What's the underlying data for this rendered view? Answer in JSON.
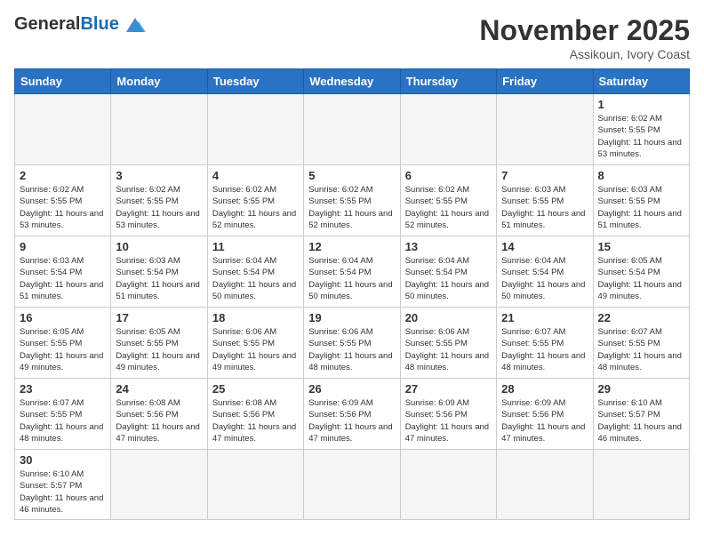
{
  "header": {
    "logo_general": "General",
    "logo_blue": "Blue",
    "month_title": "November 2025",
    "location": "Assikoun, Ivory Coast"
  },
  "weekdays": [
    "Sunday",
    "Monday",
    "Tuesday",
    "Wednesday",
    "Thursday",
    "Friday",
    "Saturday"
  ],
  "weeks": [
    [
      {
        "day": "",
        "info": ""
      },
      {
        "day": "",
        "info": ""
      },
      {
        "day": "",
        "info": ""
      },
      {
        "day": "",
        "info": ""
      },
      {
        "day": "",
        "info": ""
      },
      {
        "day": "",
        "info": ""
      },
      {
        "day": "1",
        "info": "Sunrise: 6:02 AM\nSunset: 5:55 PM\nDaylight: 11 hours\nand 53 minutes."
      }
    ],
    [
      {
        "day": "2",
        "info": "Sunrise: 6:02 AM\nSunset: 5:55 PM\nDaylight: 11 hours\nand 53 minutes."
      },
      {
        "day": "3",
        "info": "Sunrise: 6:02 AM\nSunset: 5:55 PM\nDaylight: 11 hours\nand 53 minutes."
      },
      {
        "day": "4",
        "info": "Sunrise: 6:02 AM\nSunset: 5:55 PM\nDaylight: 11 hours\nand 52 minutes."
      },
      {
        "day": "5",
        "info": "Sunrise: 6:02 AM\nSunset: 5:55 PM\nDaylight: 11 hours\nand 52 minutes."
      },
      {
        "day": "6",
        "info": "Sunrise: 6:02 AM\nSunset: 5:55 PM\nDaylight: 11 hours\nand 52 minutes."
      },
      {
        "day": "7",
        "info": "Sunrise: 6:03 AM\nSunset: 5:55 PM\nDaylight: 11 hours\nand 51 minutes."
      },
      {
        "day": "8",
        "info": "Sunrise: 6:03 AM\nSunset: 5:55 PM\nDaylight: 11 hours\nand 51 minutes."
      }
    ],
    [
      {
        "day": "9",
        "info": "Sunrise: 6:03 AM\nSunset: 5:54 PM\nDaylight: 11 hours\nand 51 minutes."
      },
      {
        "day": "10",
        "info": "Sunrise: 6:03 AM\nSunset: 5:54 PM\nDaylight: 11 hours\nand 51 minutes."
      },
      {
        "day": "11",
        "info": "Sunrise: 6:04 AM\nSunset: 5:54 PM\nDaylight: 11 hours\nand 50 minutes."
      },
      {
        "day": "12",
        "info": "Sunrise: 6:04 AM\nSunset: 5:54 PM\nDaylight: 11 hours\nand 50 minutes."
      },
      {
        "day": "13",
        "info": "Sunrise: 6:04 AM\nSunset: 5:54 PM\nDaylight: 11 hours\nand 50 minutes."
      },
      {
        "day": "14",
        "info": "Sunrise: 6:04 AM\nSunset: 5:54 PM\nDaylight: 11 hours\nand 50 minutes."
      },
      {
        "day": "15",
        "info": "Sunrise: 6:05 AM\nSunset: 5:54 PM\nDaylight: 11 hours\nand 49 minutes."
      }
    ],
    [
      {
        "day": "16",
        "info": "Sunrise: 6:05 AM\nSunset: 5:55 PM\nDaylight: 11 hours\nand 49 minutes."
      },
      {
        "day": "17",
        "info": "Sunrise: 6:05 AM\nSunset: 5:55 PM\nDaylight: 11 hours\nand 49 minutes."
      },
      {
        "day": "18",
        "info": "Sunrise: 6:06 AM\nSunset: 5:55 PM\nDaylight: 11 hours\nand 49 minutes."
      },
      {
        "day": "19",
        "info": "Sunrise: 6:06 AM\nSunset: 5:55 PM\nDaylight: 11 hours\nand 48 minutes."
      },
      {
        "day": "20",
        "info": "Sunrise: 6:06 AM\nSunset: 5:55 PM\nDaylight: 11 hours\nand 48 minutes."
      },
      {
        "day": "21",
        "info": "Sunrise: 6:07 AM\nSunset: 5:55 PM\nDaylight: 11 hours\nand 48 minutes."
      },
      {
        "day": "22",
        "info": "Sunrise: 6:07 AM\nSunset: 5:55 PM\nDaylight: 11 hours\nand 48 minutes."
      }
    ],
    [
      {
        "day": "23",
        "info": "Sunrise: 6:07 AM\nSunset: 5:55 PM\nDaylight: 11 hours\nand 48 minutes."
      },
      {
        "day": "24",
        "info": "Sunrise: 6:08 AM\nSunset: 5:56 PM\nDaylight: 11 hours\nand 47 minutes."
      },
      {
        "day": "25",
        "info": "Sunrise: 6:08 AM\nSunset: 5:56 PM\nDaylight: 11 hours\nand 47 minutes."
      },
      {
        "day": "26",
        "info": "Sunrise: 6:09 AM\nSunset: 5:56 PM\nDaylight: 11 hours\nand 47 minutes."
      },
      {
        "day": "27",
        "info": "Sunrise: 6:09 AM\nSunset: 5:56 PM\nDaylight: 11 hours\nand 47 minutes."
      },
      {
        "day": "28",
        "info": "Sunrise: 6:09 AM\nSunset: 5:56 PM\nDaylight: 11 hours\nand 47 minutes."
      },
      {
        "day": "29",
        "info": "Sunrise: 6:10 AM\nSunset: 5:57 PM\nDaylight: 11 hours\nand 46 minutes."
      }
    ],
    [
      {
        "day": "30",
        "info": "Sunrise: 6:10 AM\nSunset: 5:57 PM\nDaylight: 11 hours\nand 46 minutes."
      },
      {
        "day": "",
        "info": ""
      },
      {
        "day": "",
        "info": ""
      },
      {
        "day": "",
        "info": ""
      },
      {
        "day": "",
        "info": ""
      },
      {
        "day": "",
        "info": ""
      },
      {
        "day": "",
        "info": ""
      }
    ]
  ]
}
